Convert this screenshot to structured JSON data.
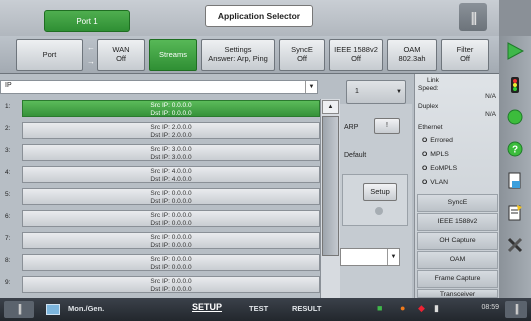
{
  "topbar": {
    "port_label": "Port 1",
    "app_selector": "Application Selector",
    "menu_glyph": "|||"
  },
  "tabs": [
    {
      "line1": "Port",
      "line2": ""
    },
    {
      "line1": "WAN",
      "line2": "Off"
    },
    {
      "line1": "Streams",
      "line2": ""
    },
    {
      "line1": "Settings",
      "line2": "Answer: Arp, Ping"
    },
    {
      "line1": "SyncE",
      "line2": "Off"
    },
    {
      "line1": "IEEE 1588v2",
      "line2": "Off"
    },
    {
      "line1": "OAM",
      "line2": "802.3ah"
    },
    {
      "line1": "Filter",
      "line2": "Off"
    }
  ],
  "filter": {
    "value": "IP"
  },
  "num_select": {
    "value": "1"
  },
  "streams": [
    {
      "idx": "1:",
      "src": "Src IP: 0.0.0.0",
      "dst": "Dst IP: 0.0.0.0"
    },
    {
      "idx": "2:",
      "src": "Src IP: 2.0.0.0",
      "dst": "Dst IP: 2.0.0.0"
    },
    {
      "idx": "3:",
      "src": "Src IP: 3.0.0.0",
      "dst": "Dst IP: 3.0.0.0"
    },
    {
      "idx": "4:",
      "src": "Src IP: 4.0.0.0",
      "dst": "Dst IP: 4.0.0.0"
    },
    {
      "idx": "5:",
      "src": "Src IP: 0.0.0.0",
      "dst": "Dst IP: 0.0.0.0"
    },
    {
      "idx": "6:",
      "src": "Src IP: 0.0.0.0",
      "dst": "Dst IP: 0.0.0.0"
    },
    {
      "idx": "7:",
      "src": "Src IP: 0.0.0.0",
      "dst": "Dst IP: 0.0.0.0"
    },
    {
      "idx": "8:",
      "src": "Src IP: 0.0.0.0",
      "dst": "Dst IP: 0.0.0.0"
    },
    {
      "idx": "9:",
      "src": "Src IP: 0.0.0.0",
      "dst": "Dst IP: 0.0.0.0"
    }
  ],
  "mid": {
    "arp_label": "ARP",
    "arp_button": "!",
    "default_label": "Default",
    "setup_button": "Setup"
  },
  "status": {
    "link": "Link",
    "speed_label": "Speed:",
    "speed_value": "N/A",
    "duplex_label": "Duplex",
    "duplex_value": "N/A",
    "ethernet_label": "Ethernet",
    "eth_items": [
      "Errored",
      "MPLS",
      "EoMPLS",
      "VLAN"
    ],
    "features": [
      "SyncE",
      "IEEE 1588v2",
      "OH Capture",
      "OAM",
      "Frame Capture",
      "Transceiver"
    ]
  },
  "bottombar": {
    "mode": "Mon./Gen.",
    "setup": "SETUP",
    "test": "TEST",
    "result": "RESULT",
    "time": "08:59"
  },
  "colors": {
    "accent_green": "#36923a"
  }
}
